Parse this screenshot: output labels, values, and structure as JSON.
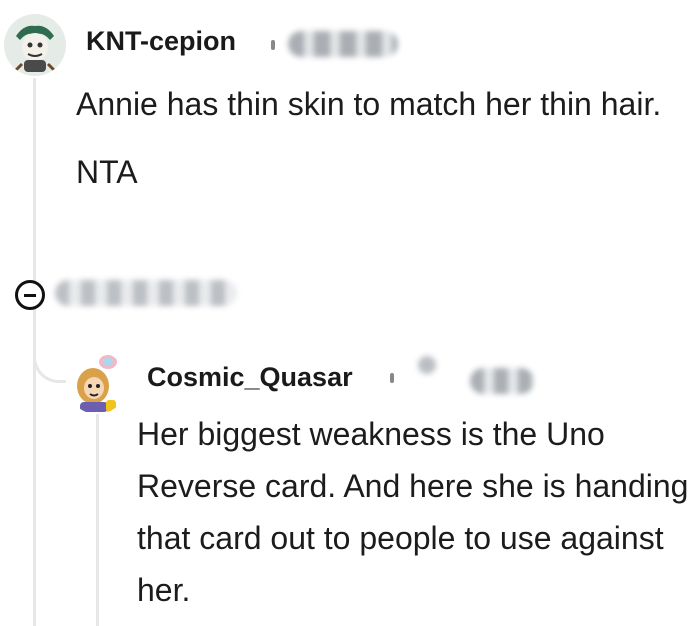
{
  "comments": [
    {
      "username": "KNT-cepion",
      "avatar_icon": "avatar-icon",
      "paragraphs": [
        "Annie has thin skin to match her thin hair.",
        "NTA"
      ]
    },
    {
      "username": "Cosmic_Quasar",
      "avatar_icon": "avatar-icon",
      "paragraphs": [
        "Her biggest weakness is the Uno Reverse card. And here she is handing that card out to people to use against her."
      ]
    }
  ],
  "controls": {
    "collapse_icon": "collapse-icon"
  }
}
